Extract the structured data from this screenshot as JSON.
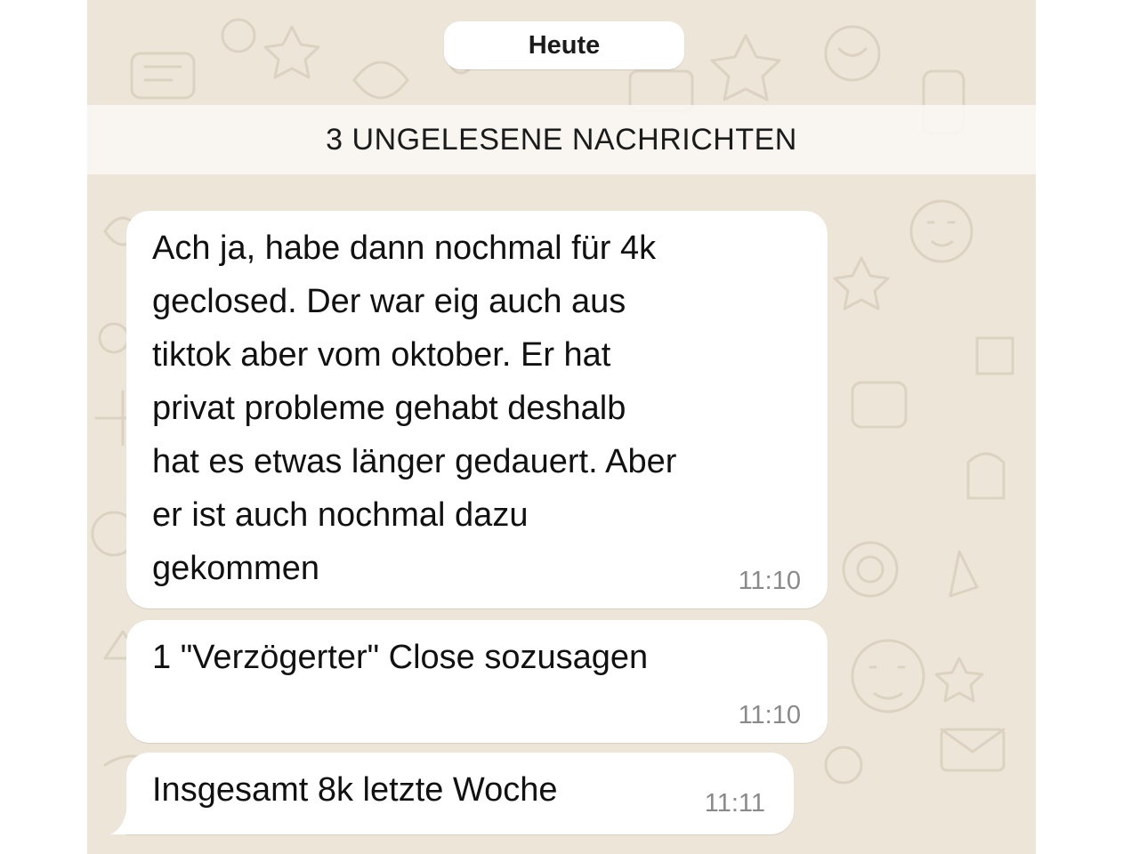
{
  "chat": {
    "date_label": "Heute",
    "unread_banner": "3 UNGELESENE NACHRICHTEN",
    "background_color": "#ede5d8",
    "bubble_color": "#ffffff",
    "messages": [
      {
        "text": "Ach ja, habe dann nochmal für 4k\ngeclosed. Der war eig auch aus\ntiktok aber vom oktober. Er hat\nprivat probleme gehabt deshalb\nhat es etwas länger gedauert. Aber\ner ist auch nochmal dazu\ngekommen",
        "time": "11:10"
      },
      {
        "text": "1 \"Verzögerter\" Close sozusagen",
        "time": "11:10"
      },
      {
        "text": "Insgesamt 8k letzte Woche",
        "time": "11:11"
      }
    ]
  }
}
